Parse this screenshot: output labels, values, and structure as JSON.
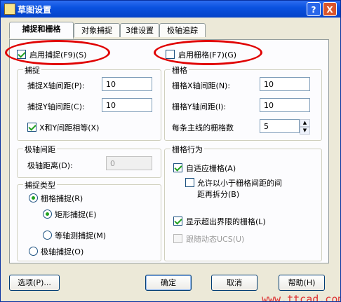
{
  "window": {
    "title": "草图设置",
    "help": "?",
    "close": "X"
  },
  "tabs": [
    "捕捉和栅格",
    "对象捕捉",
    "3维设置",
    "极轴追踪"
  ],
  "snap": {
    "enable_label": "启用捕捉(F9)(S)",
    "group": "捕捉",
    "x_label": "捕捉X轴间距(P):",
    "x_value": "10",
    "y_label": "捕捉Y轴间距(C):",
    "y_value": "10",
    "equal_label": "X和Y间距相等(X)"
  },
  "grid": {
    "enable_label": "启用栅格(F7)(G)",
    "group": "栅格",
    "x_label": "栅格X轴间距(N):",
    "x_value": "10",
    "y_label": "栅格Y轴间距(I):",
    "y_value": "10",
    "major_label": "每条主线的栅格数",
    "major_value": "5"
  },
  "polar": {
    "group": "极轴间距",
    "distance_label": "极轴距离(D):",
    "distance_value": "0"
  },
  "snap_type": {
    "group": "捕捉类型",
    "grid_snap": "栅格捕捉(R)",
    "rect_snap": "矩形捕捉(E)",
    "iso_snap": "等轴测捕捉(M)",
    "polar_snap": "极轴捕捉(O)"
  },
  "grid_behavior": {
    "group": "栅格行为",
    "adaptive": "自适应栅格(A)",
    "subdivide_line1": "允许以小于栅格间距的间",
    "subdivide_line2": "距再拆分(B)",
    "beyond_limits": "显示超出界限的栅格(L)",
    "follow_ucs": "跟随动态UCS(U)"
  },
  "buttons": {
    "options": "选项(P)...",
    "ok": "确定",
    "cancel": "取消",
    "help": "帮助(H)"
  },
  "watermark": "www.ttcad.com"
}
